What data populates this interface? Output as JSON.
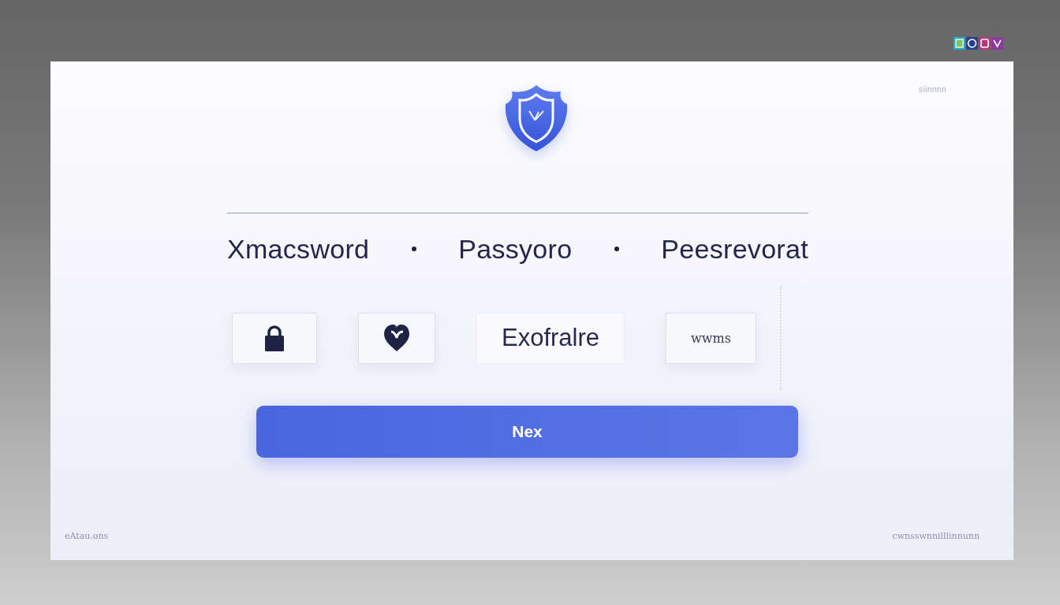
{
  "card": {
    "corner_label": "siinnnn",
    "heading": [
      "Xmacsword",
      "Passyoro",
      "Peesrevorat"
    ],
    "tiles": [
      {
        "kind": "icon"
      },
      {
        "kind": "icon"
      },
      {
        "kind": "plain",
        "label": "Exofralre"
      },
      {
        "kind": "card",
        "label": "wwms"
      }
    ],
    "next_button": {
      "label": "Nex"
    },
    "footer": {
      "left": "eAtau.ons",
      "right": "cwnsswnnilllinnunn"
    }
  }
}
